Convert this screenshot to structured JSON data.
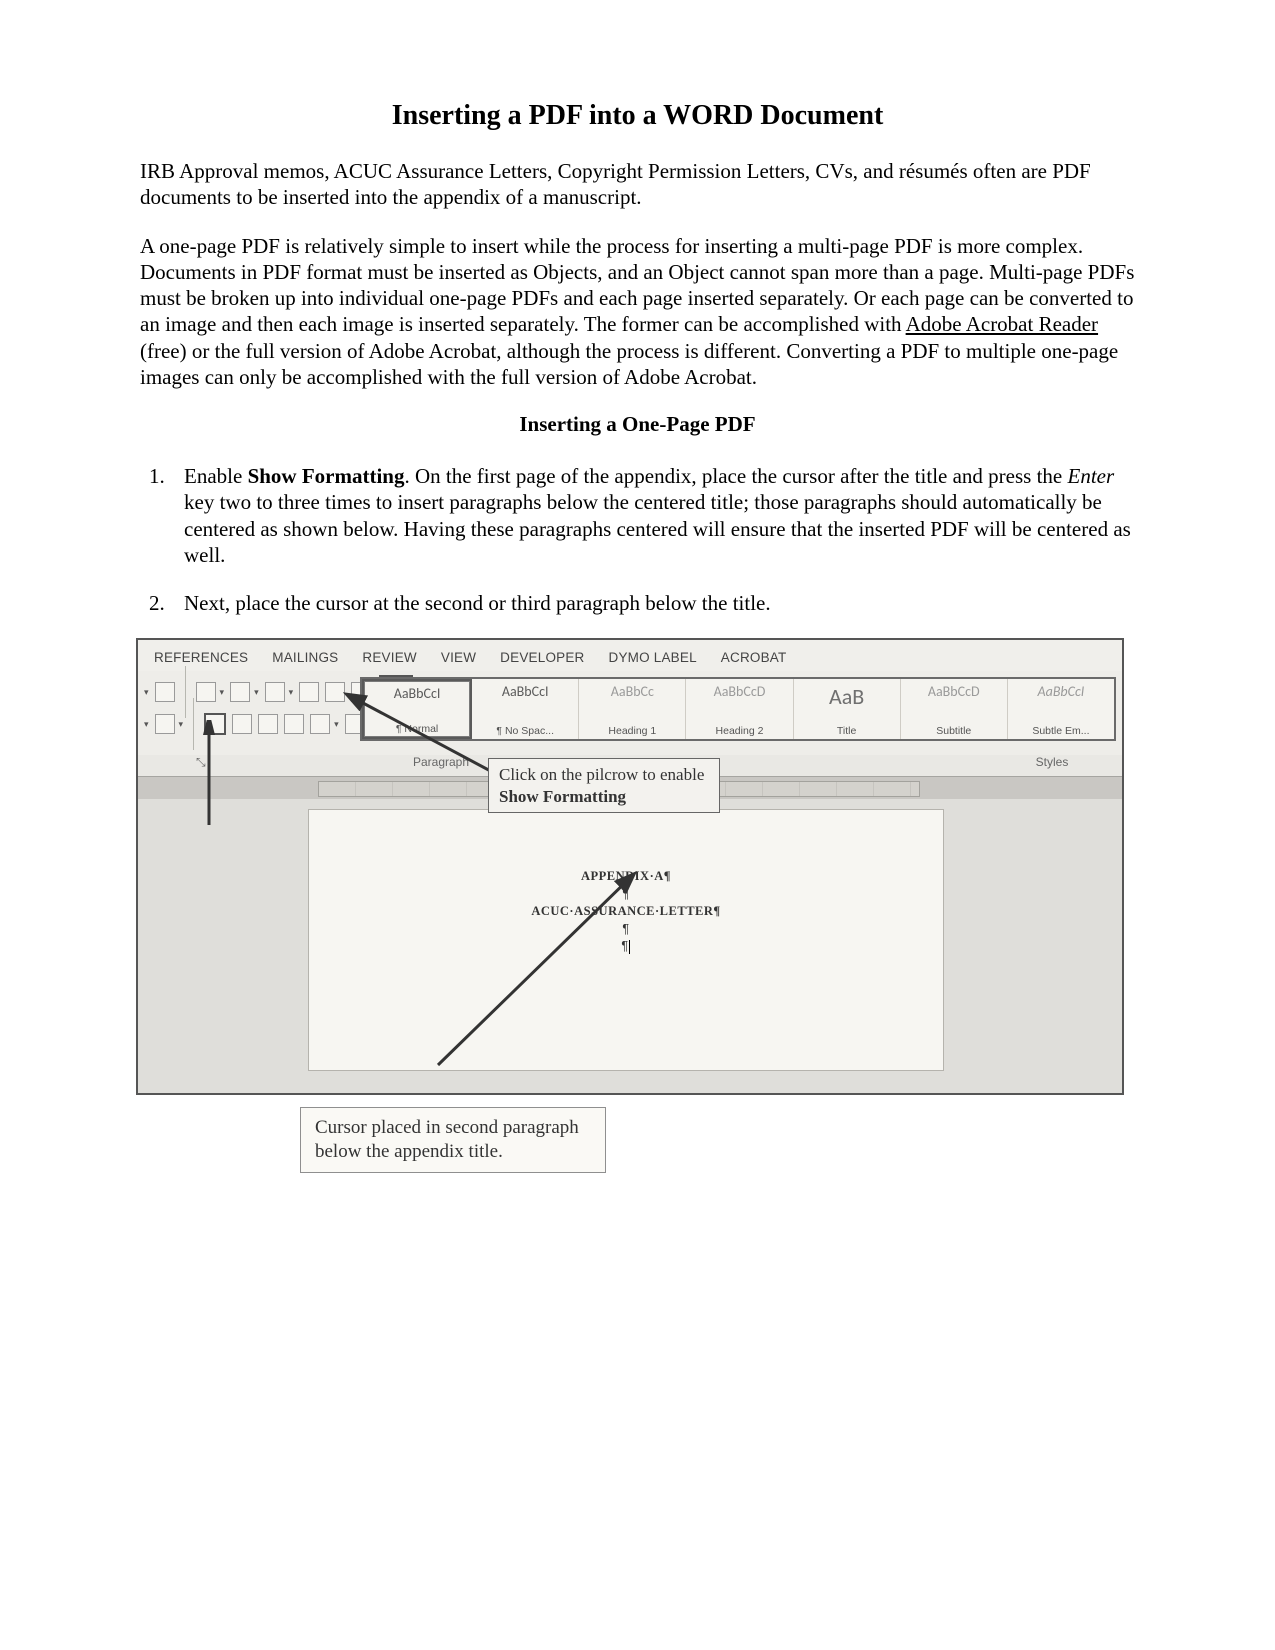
{
  "title": "Inserting a PDF into a WORD Document",
  "intro1": "IRB Approval memos, ACUC Assurance Letters, Copyright Permission Letters, CVs, and résumés often are PDF documents to be inserted into the appendix of a manuscript.",
  "intro2a": "A one-page PDF is relatively simple to insert while the process for inserting a multi-page PDF is more complex. Documents in PDF format must be inserted as Objects, and an Object cannot span more than a page. Multi-page PDFs must be broken up into individual one-page PDFs and each page inserted separately. Or each page can be converted to an image and then each image is inserted separately. The former can be accomplished with ",
  "intro2_link": "Adobe Acrobat Reader",
  "intro2b": " (free) or the full version of Adobe Acrobat, although the process is different. Converting a PDF to multiple one-page images can only be accomplished with the full version of Adobe Acrobat.",
  "section1_title": "Inserting a One-Page PDF",
  "step1_a": "Enable ",
  "step1_b": "Show Formatting",
  "step1_c": ". On the first page of the appendix, place the cursor after the title and press the ",
  "step1_d": "Enter",
  "step1_e": " key two to three times to insert paragraphs below the centered title; those paragraphs should automatically be centered as shown below. Having these paragraphs centered will ensure that the inserted PDF will be centered as well.",
  "step2": "Next, place the cursor at the second or third paragraph below the title.",
  "ribbon": {
    "tabs": [
      "REFERENCES",
      "MAILINGS",
      "REVIEW",
      "VIEW",
      "DEVELOPER",
      "DYMO Label",
      "ACROBAT"
    ],
    "group_paragraph": "Paragraph",
    "group_styles": "Styles",
    "styles": [
      {
        "sample": "AaBbCcI",
        "name": "¶ Normal",
        "cls": "sel"
      },
      {
        "sample": "AaBbCcI",
        "name": "¶ No Spac...",
        "cls": ""
      },
      {
        "sample": "AaBbCc",
        "name": "Heading 1",
        "cls": "gray"
      },
      {
        "sample": "AaBbCcD",
        "name": "Heading 2",
        "cls": "gray"
      },
      {
        "sample": "AaB",
        "name": "Title",
        "cls": "big"
      },
      {
        "sample": "AaBbCcD",
        "name": "Subtitle",
        "cls": "gray"
      },
      {
        "sample": "AaBbCcI",
        "name": "Subtle Em...",
        "cls": "ital gray"
      }
    ],
    "pilcrow": "¶"
  },
  "doc": {
    "line1": "APPENDIX·A¶",
    "pilc": "¶",
    "line2": "ACUC·ASSURANCE·LETTER¶"
  },
  "callout1_a": "Click on the pilcrow to enable ",
  "callout1_b": "Show Formatting",
  "callout2": "Cursor placed in second paragraph below the appendix title."
}
